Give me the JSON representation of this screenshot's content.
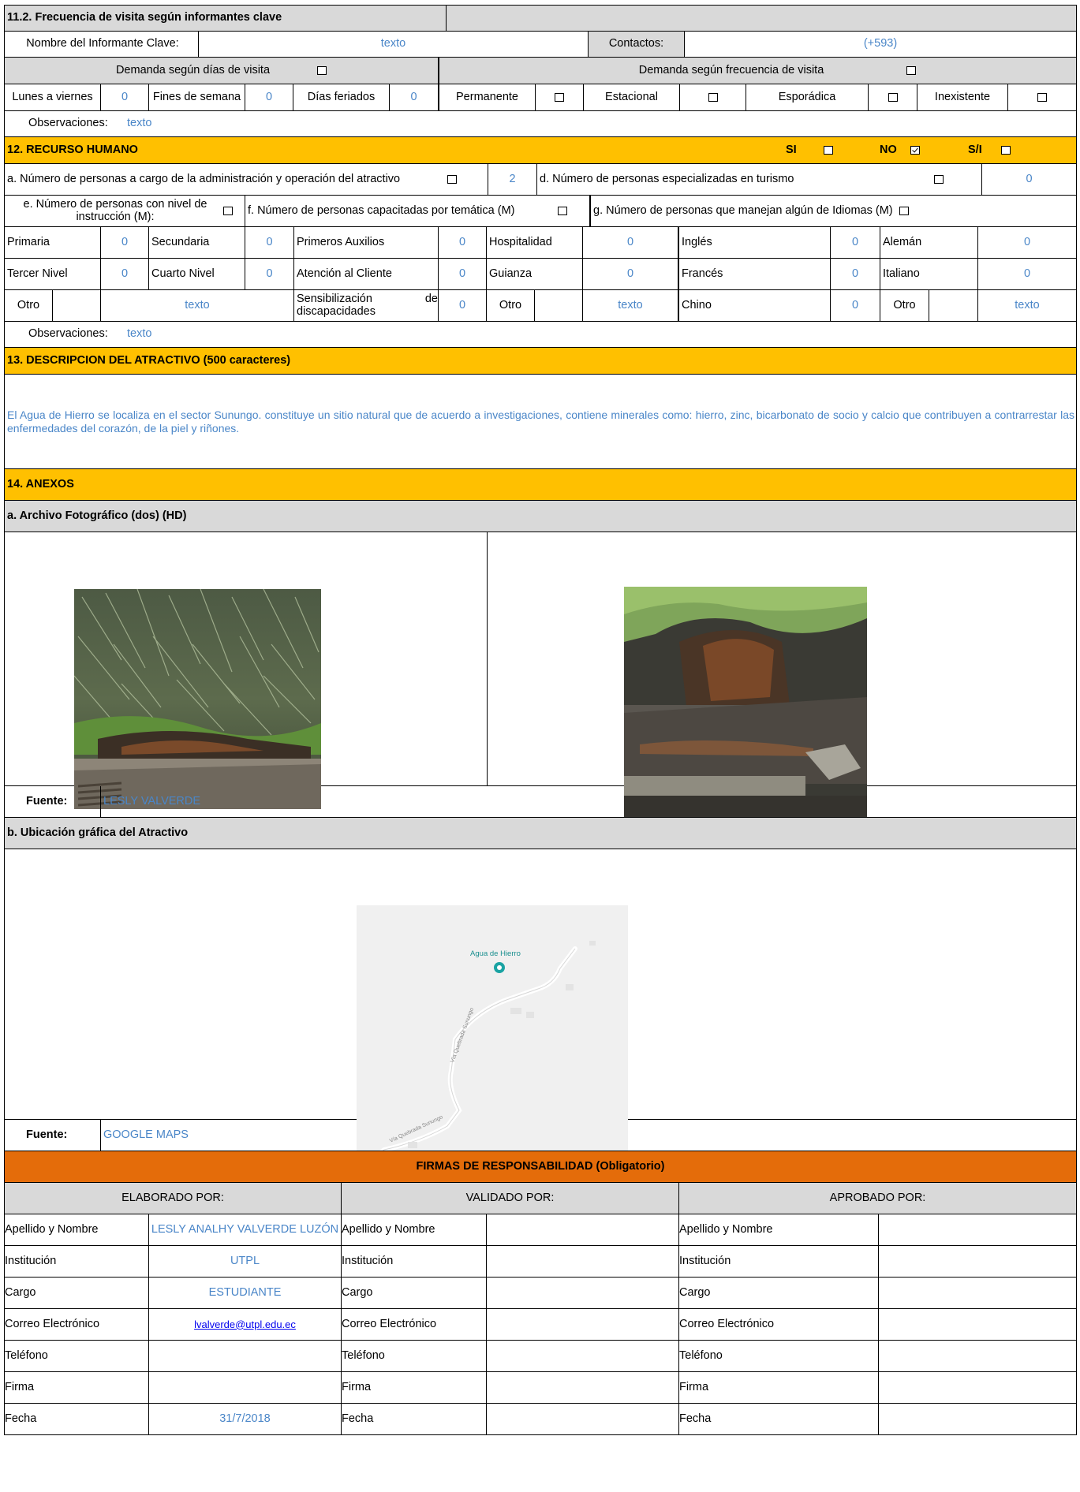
{
  "s11_2": {
    "title": "11.2. Frecuencia de visita según informantes clave",
    "informante_label": "Nombre del Informante Clave:",
    "informante_value": "texto",
    "contactos_label": "Contactos:",
    "contactos_value": "(+593)",
    "demanda_dias": "Demanda según  días de visita",
    "demanda_frec": "Demanda según frecuencia de visita",
    "lunes_label": "Lunes a viernes",
    "lunes_value": "0",
    "fines_label": "Fines de semana",
    "fines_value": "0",
    "feriados_label": "Días feriados",
    "feriados_value": "0",
    "permanente": "Permanente",
    "estacional": "Estacional",
    "esporadica": "Esporádica",
    "inexistente": "Inexistente",
    "obs_label": "Observaciones:",
    "obs_value": "texto"
  },
  "s12": {
    "title": "12. RECURSO HUMANO",
    "si": "SI",
    "no": "NO",
    "si_checked": false,
    "no_checked": true,
    "sin_info": "S/I",
    "a_label": "a. Número de personas a cargo de la administración y operación del atractivo",
    "a_value": "2",
    "d_label": "d. Número de personas especializadas en turismo",
    "d_value": "0",
    "e_label": "e. Número de personas con nivel de instrucción (M):",
    "f_label": "f. Número de personas capacitadas por temática (M)",
    "g_label": "g. Número de personas que manejan algún de Idiomas (M)",
    "primaria": "Primaria",
    "primaria_v": "0",
    "secundaria": "Secundaria",
    "secundaria_v": "0",
    "tercer": "Tercer Nivel",
    "tercer_v": "0",
    "cuarto": "Cuarto Nivel",
    "cuarto_v": "0",
    "otro": "Otro",
    "otro_v": "texto",
    "primeros": "Primeros Auxilios",
    "primeros_v": "0",
    "hospitalidad": "Hospitalidad",
    "hospitalidad_v": "0",
    "atencion": "Atención al Cliente",
    "atencion_v": "0",
    "guianza": "Guianza",
    "guianza_v": "0",
    "sensib": "Sensibilización de discapacidades",
    "sensib_v": "0",
    "otro2": "Otro",
    "otro2_v": "texto",
    "ingles": "Inglés",
    "ingles_v": "0",
    "aleman": "Alemán",
    "aleman_v": "0",
    "frances": "Francés",
    "frances_v": "0",
    "italiano": "Italiano",
    "italiano_v": "0",
    "chino": "Chino",
    "chino_v": "0",
    "otro3": "Otro",
    "otro3_v": "texto",
    "obs_label": "Observaciones:",
    "obs_value": "texto"
  },
  "s13": {
    "title": "13. DESCRIPCION DEL ATRACTIVO (500 caracteres)",
    "text": "El Agua de Hierro se localiza en el sector Sunungo. constituye un sitio natural que de acuerdo a investigaciones, contiene minerales como: hierro, zinc, bicarbonato de socio y calcio que contribuyen a contrarrestar las enfermedades del corazón, de la piel y riñones."
  },
  "s14": {
    "title": "14. ANEXOS",
    "photos_title": "a. Archivo Fotográfico (dos) (HD)",
    "fuente_label": "Fuente:",
    "fuente_photos": "LESLY VALVERDE",
    "map_title": "b. Ubicación gráfica del Atractivo",
    "map_place": "Agua de Hierro",
    "map_road1": "Vía Quebrada Sunungo",
    "map_road2": "Vía Quebrada Sunungo",
    "fuente_map": "GOOGLE MAPS"
  },
  "firmas": {
    "title": "FIRMAS DE RESPONSABILIDAD (Obligatorio)",
    "elaborado": "ELABORADO POR:",
    "validado": "VALIDADO  POR:",
    "aprobado": "APROBADO POR:",
    "labels": [
      "Apellido y Nombre",
      "Institución",
      "Cargo",
      "Correo Electrónico",
      "Teléfono",
      "Firma",
      "Fecha"
    ],
    "elaborado_values": [
      "LESLY ANALHY VALVERDE LUZÓN",
      "UTPL",
      "ESTUDIANTE",
      "lvalverde@utpl.edu.ec",
      "",
      "",
      "31/7/2018"
    ]
  },
  "colors": {
    "gray": "#d9d9d9",
    "yellow": "#ffc000",
    "orange": "#e46c0a",
    "blue_text": "#4a86c8"
  }
}
